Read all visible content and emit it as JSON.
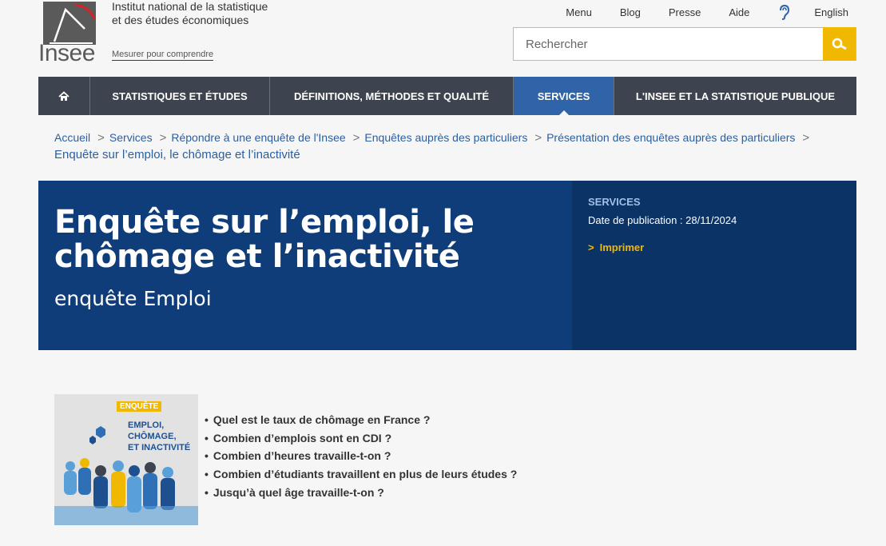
{
  "header": {
    "logo_word": "Insee",
    "institute_name_line1": "Institut national de la statistique",
    "institute_name_line2": "et des études économiques",
    "tagline": "Mesurer pour comprendre",
    "top_links": [
      "Menu",
      "Blog",
      "Presse",
      "Aide",
      "English"
    ],
    "search_placeholder": "Rechercher"
  },
  "nav": {
    "home_icon": "home-icon",
    "items": [
      "STATISTIQUES ET ÉTUDES",
      "DÉFINITIONS, MÉTHODES ET QUALITÉ",
      "SERVICES",
      "L'INSEE ET LA STATISTIQUE PUBLIQUE"
    ],
    "active": "SERVICES"
  },
  "breadcrumb": {
    "items": [
      "Accueil",
      "Services",
      "Répondre à une enquête de l'Insee",
      "Enquêtes auprès des particuliers",
      "Présentation des enquêtes auprès des particuliers"
    ],
    "current": "Enquête sur l’emploi, le chômage et l’inactivité"
  },
  "banner": {
    "title_line1": "Enquête sur l’emploi, le",
    "title_line2": "chômage et l’inactivité",
    "subtitle": "enquête Emploi",
    "category": "SERVICES",
    "publication_date": "Date de publication : 28/11/2024",
    "print_label": "Imprimer"
  },
  "content": {
    "thumbnail_tag": "ENQUÊTE",
    "thumbnail_line1": "EMPLOI,",
    "thumbnail_line2": "CHÔMAGE,",
    "thumbnail_line3": "ET INACTIVITÉ",
    "questions": [
      "Quel est le taux de chômage en France ?",
      "Combien d’emplois sont en CDI ?",
      "Combien d’heures travaille-t-on ?",
      "Combien d’étudiants travaillent en plus de leurs études ?",
      "Jusqu’à quel âge travaille-t-on ?"
    ]
  },
  "colors": {
    "nav_bg": "#3d4450",
    "nav_active": "#2f64a8",
    "banner_bg": "#0f3d7a",
    "accent_yellow": "#f0b800",
    "link_blue": "#2b5fa0"
  }
}
